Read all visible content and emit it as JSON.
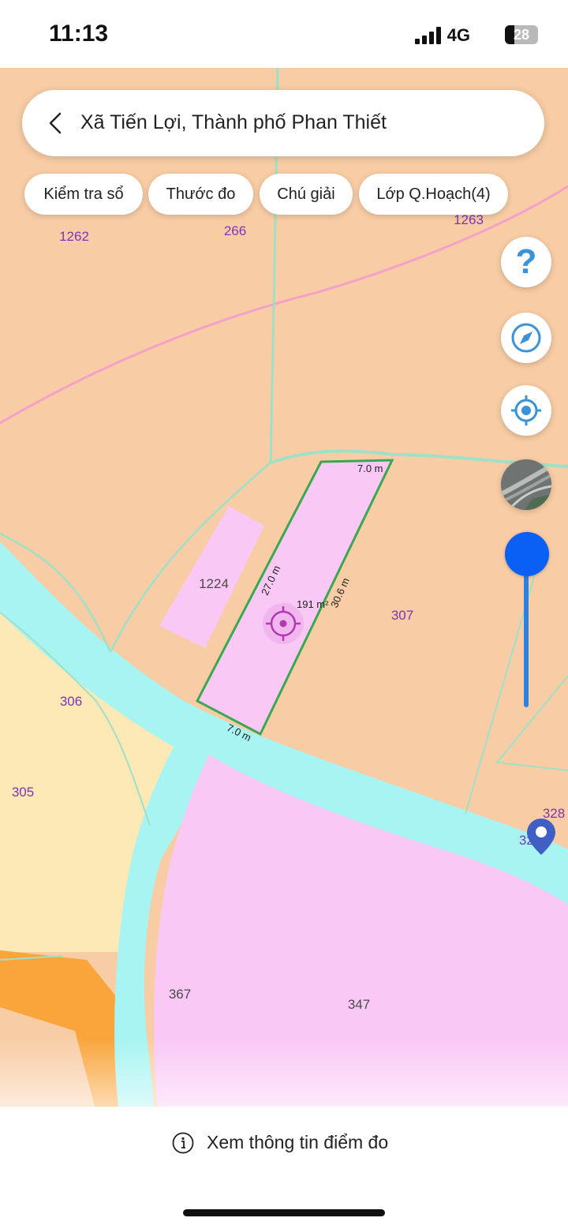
{
  "status_bar": {
    "time": "11:13",
    "network": "4G",
    "battery": "28",
    "battery_level_percent": 28
  },
  "search": {
    "title": "Xã Tiến Lợi, Thành phố Phan Thiết"
  },
  "chips": [
    "Kiểm tra sổ",
    "Thước đo",
    "Chú giải",
    "Lớp Q.Hoạch(4)"
  ],
  "side_controls": {
    "help_symbol": "?",
    "buttons": [
      "help-icon",
      "compass-icon",
      "locate-icon",
      "satellite-layer-icon"
    ],
    "zoom_level_percent": 100
  },
  "map": {
    "parcel_labels": [
      "1262",
      "266",
      "1263",
      "1224",
      "307",
      "306",
      "305",
      "328",
      "327",
      "367",
      "347"
    ],
    "selected_parcel": {
      "area": "191 m²",
      "edge_top": "7.0 m",
      "edge_left": "27.0 m",
      "edge_right": "30.6 m",
      "edge_bottom": "7.0 m"
    },
    "colors": {
      "residential_land": "#f8cda5",
      "selected_parcel": "#f9c8f5",
      "water": "#a8f4f2",
      "agricultural": "#fde9b5",
      "road": "#f9a53c",
      "parcel_outline": "#38a852"
    }
  },
  "bottom": {
    "info_label": "Xem thông tin điểm đo"
  }
}
